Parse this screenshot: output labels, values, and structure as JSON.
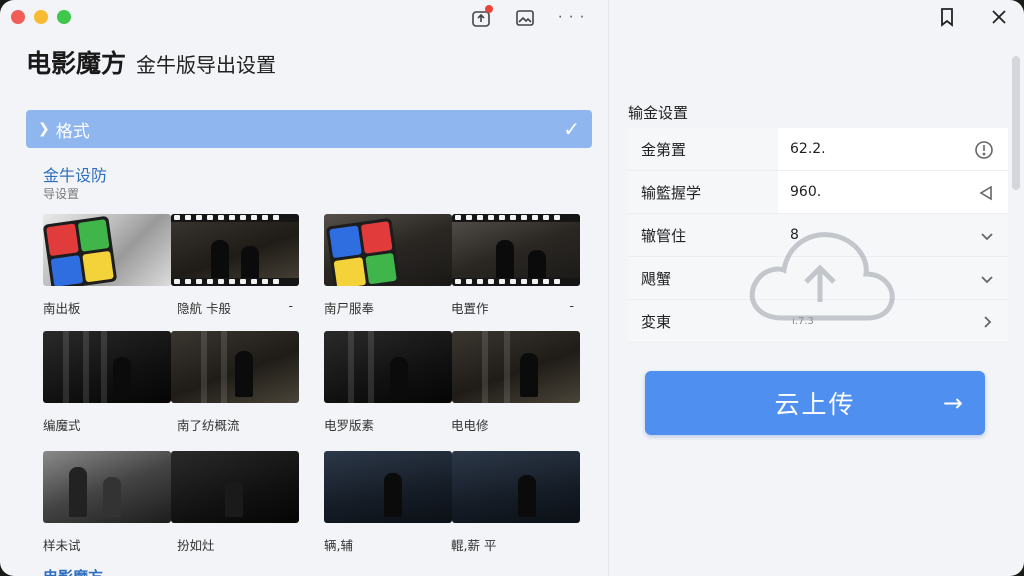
{
  "window": {
    "app_name": "电影魔方",
    "subtitle": "金牛版导出设置"
  },
  "format_section": {
    "label": "格式",
    "group_title": "金牛设防",
    "group_subtitle": "导设置",
    "tiles": [
      {
        "caption": "南出板",
        "extra": "-",
        "style": "cube-gray"
      },
      {
        "caption": "隐航 卡般",
        "extra": "",
        "style": "film-dark"
      },
      {
        "caption": "南尸服奉",
        "extra": "",
        "style": "cube-film"
      },
      {
        "caption": "电置作",
        "extra": "-",
        "style": "film-smoke"
      },
      {
        "caption": "编魔式",
        "extra": "",
        "style": "dark"
      },
      {
        "caption": "南了纺概流",
        "extra": "",
        "style": "dark"
      },
      {
        "caption": "电罗版素",
        "extra": "",
        "style": "dark"
      },
      {
        "caption": "电电修",
        "extra": "",
        "style": "dark"
      },
      {
        "caption": "样未试",
        "extra": "",
        "style": "mono"
      },
      {
        "caption": "扮如灶",
        "extra": "",
        "style": "black"
      },
      {
        "caption": "辆,辅",
        "extra": "",
        "style": "night"
      },
      {
        "caption": "輥,薪 平",
        "extra": "",
        "style": "night"
      }
    ],
    "next_group_peek": "电影魔方"
  },
  "settings": {
    "title": "输金设置",
    "rows": [
      {
        "label": "金第置",
        "value": "62.2.",
        "icon": "info-icon"
      },
      {
        "label": "输籃握学",
        "value": "960.",
        "icon": "send-icon"
      },
      {
        "label": "辙管住",
        "value": "8",
        "icon": "chevron-down-icon"
      },
      {
        "label": "飓蟹",
        "value": "",
        "icon": "chevron-down-icon"
      },
      {
        "label": "変東",
        "value": "ı.7.3",
        "icon": "chevron-right-icon"
      }
    ]
  },
  "upload": {
    "label": "云上传"
  },
  "colors": {
    "accent": "#4f8ff0",
    "section_bar": "#8fb6ee",
    "link": "#2f6fbf"
  }
}
